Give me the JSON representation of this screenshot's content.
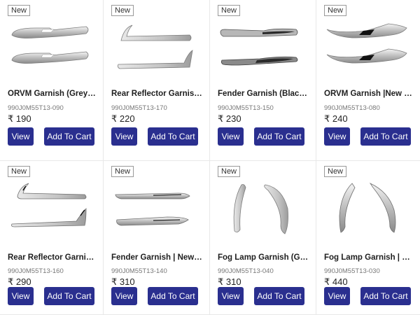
{
  "currency_symbol": "₹",
  "colors": {
    "button": "#2a2f8f",
    "badge_border": "#9a9a9a"
  },
  "products": [
    {
      "badge": "New",
      "name": "ORVM Garnish (Grey) | New Baleno",
      "sku": "990J0M55T13-090",
      "price": "₹ 190",
      "view_label": "View",
      "cart_label": "Add To Cart",
      "image": "orvm-garnish-grey-image"
    },
    {
      "badge": "New",
      "name": "Rear Reflector Garnish (Grey) | New Baleno",
      "sku": "990J0M55T13-170",
      "price": "₹ 220",
      "view_label": "View",
      "cart_label": "Add To Cart",
      "image": "rear-reflector-garnish-grey-image"
    },
    {
      "badge": "New",
      "name": "Fender Garnish (Black) | New Baleno",
      "sku": "990J0M55T13-150",
      "price": "₹ 230",
      "view_label": "View",
      "cart_label": "Add To Cart",
      "image": "fender-garnish-black-image"
    },
    {
      "badge": "New",
      "name": "ORVM Garnish |New Baleno",
      "sku": "990J0M55T13-080",
      "price": "₹ 240",
      "view_label": "View",
      "cart_label": "Add To Cart",
      "image": "orvm-garnish-image"
    },
    {
      "badge": "New",
      "name": "Rear Reflector Garnish | New Baleno",
      "sku": "990J0M55T13-160",
      "price": "₹ 290",
      "view_label": "View",
      "cart_label": "Add To Cart",
      "image": "rear-reflector-garnish-image"
    },
    {
      "badge": "New",
      "name": "Fender Garnish | New Baleno",
      "sku": "990J0M55T13-140",
      "price": "₹ 310",
      "view_label": "View",
      "cart_label": "Add To Cart",
      "image": "fender-garnish-image"
    },
    {
      "badge": "New",
      "name": "Fog Lamp Garnish (Grey) | New Baleno",
      "sku": "990J0M55T13-040",
      "price": "₹ 310",
      "view_label": "View",
      "cart_label": "Add To Cart",
      "image": "fog-lamp-garnish-grey-image"
    },
    {
      "badge": "New",
      "name": "Fog Lamp Garnish | New Baleno",
      "sku": "990J0M55T13-030",
      "price": "₹ 440",
      "view_label": "View",
      "cart_label": "Add To Cart",
      "image": "fog-lamp-garnish-image"
    }
  ]
}
